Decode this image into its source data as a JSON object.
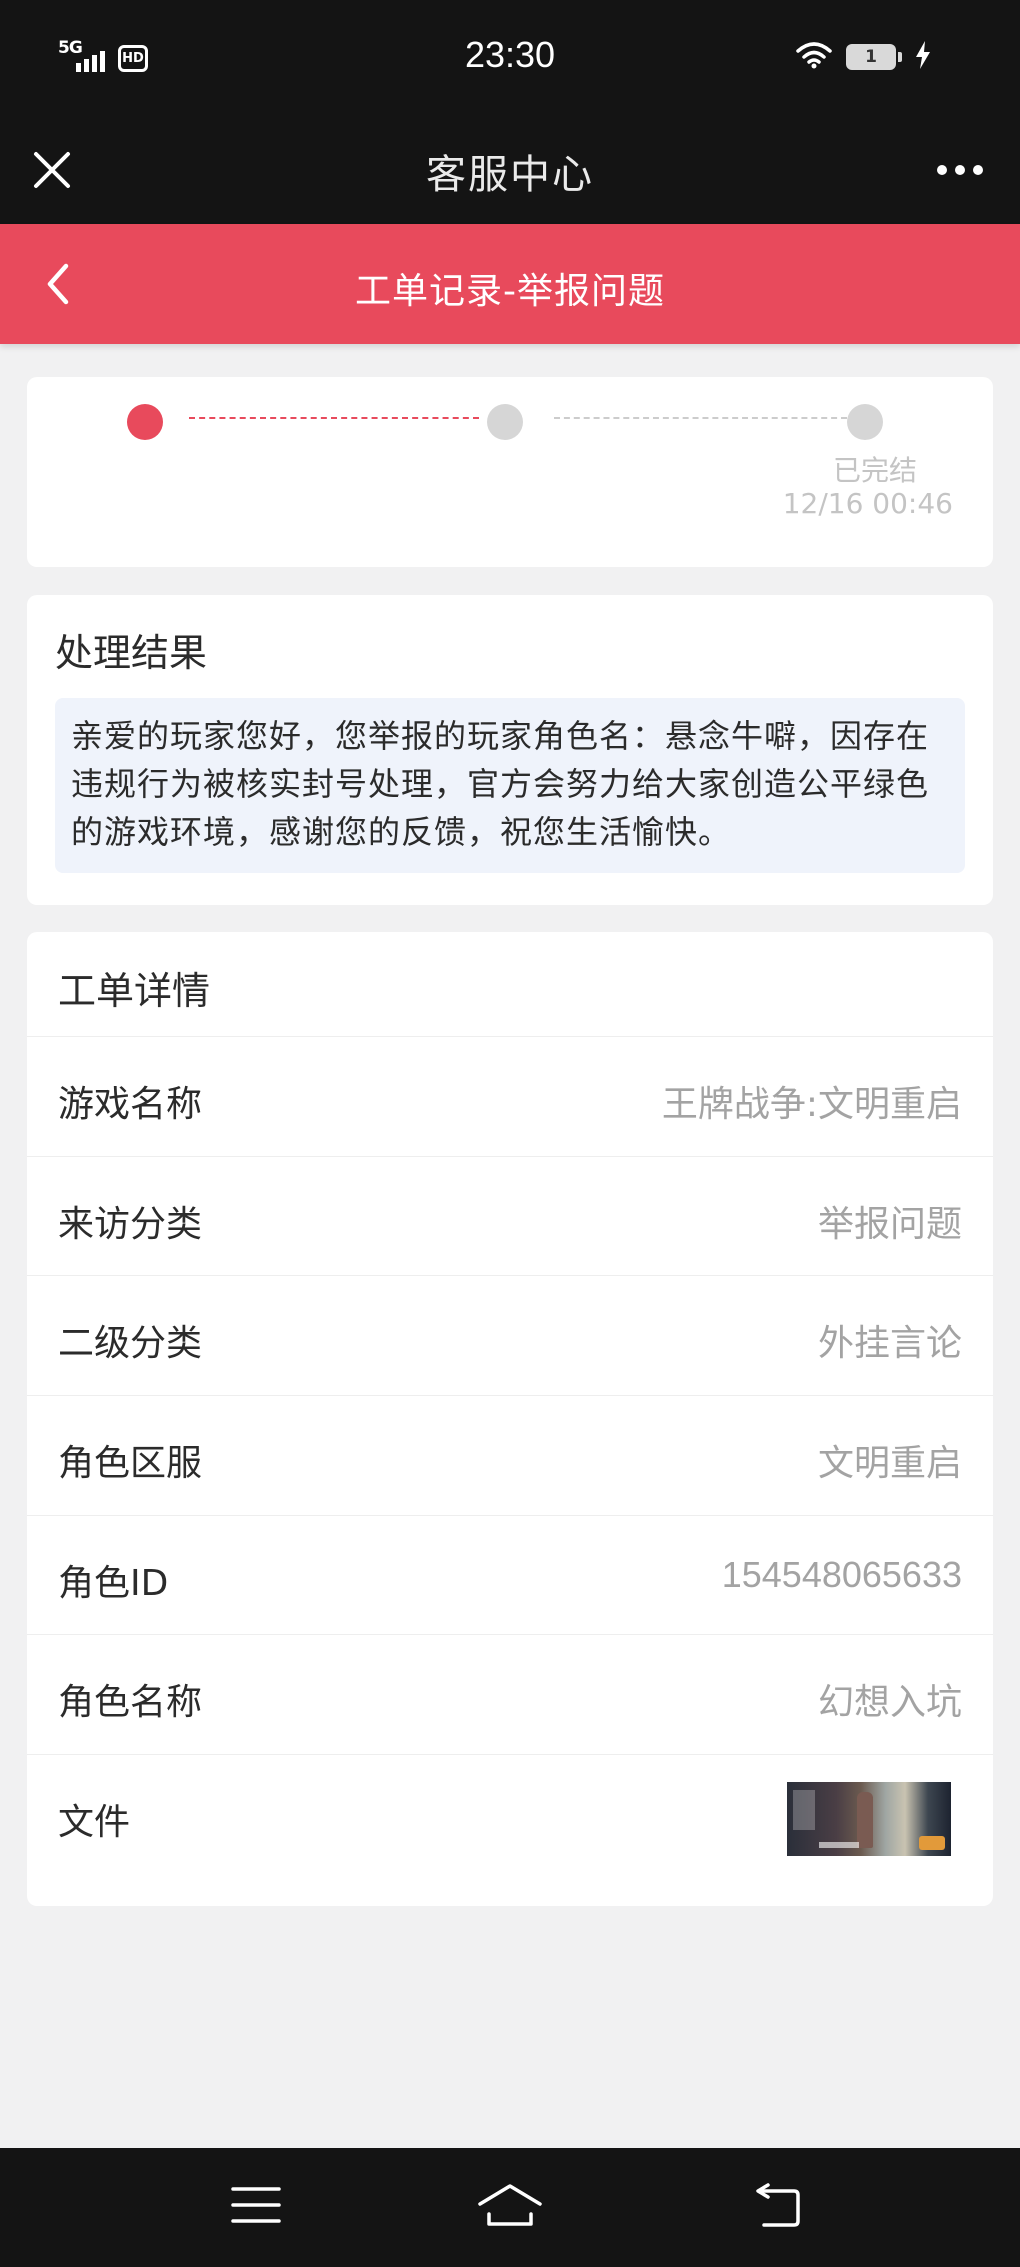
{
  "status_bar": {
    "network": "5G",
    "hd_badge": "HD",
    "time": "23:30",
    "battery_level": "1"
  },
  "nav": {
    "title": "客服中心",
    "close_icon": "close-icon",
    "more_icon": "more-dots-icon"
  },
  "header": {
    "title": "工单记录-举报问题",
    "back_icon": "chevron-left-icon"
  },
  "progress": {
    "steps": [
      {
        "state": "active",
        "color": "#e84a5c"
      },
      {
        "state": "pending",
        "color": "#d6d6d6"
      },
      {
        "state": "done",
        "color": "#d6d6d6"
      }
    ],
    "final_label": "已完结",
    "final_time": "12/16 00:46"
  },
  "result": {
    "heading": "处理结果",
    "message": "亲爱的玩家您好，您举报的玩家角色名：悬念牛噼，因存在违规行为被核实封号处理，官方会努力给大家创造公平绿色的游戏环境，感谢您的反馈，祝您生活愉快。"
  },
  "details": {
    "heading": "工单详情",
    "rows": [
      {
        "label": "游戏名称",
        "value": "王牌战争:文明重启"
      },
      {
        "label": "来访分类",
        "value": "举报问题"
      },
      {
        "label": "二级分类",
        "value": "外挂言论"
      },
      {
        "label": "角色区服",
        "value": "文明重启"
      },
      {
        "label": "角色ID",
        "value": "154548065633"
      },
      {
        "label": "角色名称",
        "value": "幻想入坑"
      },
      {
        "label": "文件",
        "value": ""
      }
    ]
  },
  "bottom_nav": {
    "menu_icon": "menu-icon",
    "home_icon": "home-icon",
    "back_icon": "back-icon"
  },
  "colors": {
    "accent": "#e84a5c",
    "dark_bar": "#141414",
    "background": "#f1f1f2",
    "result_box": "#eff3fb"
  }
}
